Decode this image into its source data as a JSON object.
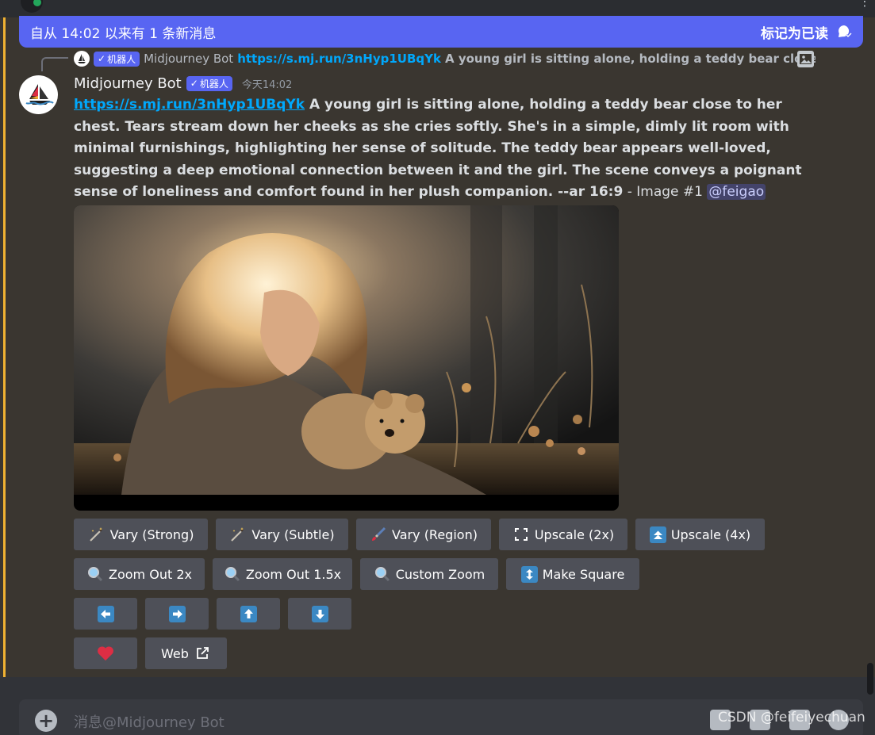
{
  "banner": {
    "text": "自从 14:02 以来有 1 条新消息",
    "mark_read": "标记为已读"
  },
  "reply_preview": {
    "bot_tag": "机器人",
    "author": "Midjourney Bot",
    "link": "https://s.mj.run/3nHyp1UBqYk",
    "text": "A young girl is sitting alone, holding a teddy bear close to l"
  },
  "message": {
    "author": "Midjourney Bot",
    "bot_tag": "机器人",
    "timestamp": "今天14:02",
    "link": "https://s.mj.run/3nHyp1UBqYk",
    "prompt": " A young girl is sitting alone, holding a teddy bear close to her chest. Tears stream down her cheeks as she cries softly. She's in a simple, dimly lit room with minimal furnishings, highlighting her sense of solitude. The teddy bear appears well-loved, suggesting a deep emotional connection between it and the girl. The scene conveys a poignant sense of loneliness and comfort found in her plush companion. --ar 16:9",
    "suffix": " - Image #1 ",
    "mention": "@feigao"
  },
  "buttons": {
    "vary_strong": "Vary (Strong)",
    "vary_subtle": "Vary (Subtle)",
    "vary_region": "Vary (Region)",
    "upscale_2x": "Upscale (2x)",
    "upscale_4x": "Upscale (4x)",
    "zoom_out_2x": "Zoom Out 2x",
    "zoom_out_15x": "Zoom Out 1.5x",
    "custom_zoom": "Custom Zoom",
    "make_square": "Make Square",
    "web": "Web"
  },
  "icons": {
    "vary": "magic-wand-icon",
    "region": "paintbrush-icon",
    "upscale_2x": "expand-icon",
    "upscale_4x": "double-up-arrow-icon",
    "zoom": "magnifier-icon",
    "make_square": "up-down-arrow-icon",
    "pan_left": "left-arrow-icon",
    "pan_right": "right-arrow-icon",
    "pan_up": "up-arrow-icon",
    "pan_down": "down-arrow-icon",
    "favorite": "heart-icon",
    "web": "external-link-icon"
  },
  "composer": {
    "placeholder": "消息@Midjourney Bot"
  },
  "watermark": "CSDN @feifeiyechuan",
  "colors": {
    "blurple": "#5865f2",
    "link": "#00a8fc",
    "highlight": "#f0b232",
    "button": "#4e5058",
    "arrow_blue": "#3b88c3",
    "heart": "#dd2e44"
  }
}
